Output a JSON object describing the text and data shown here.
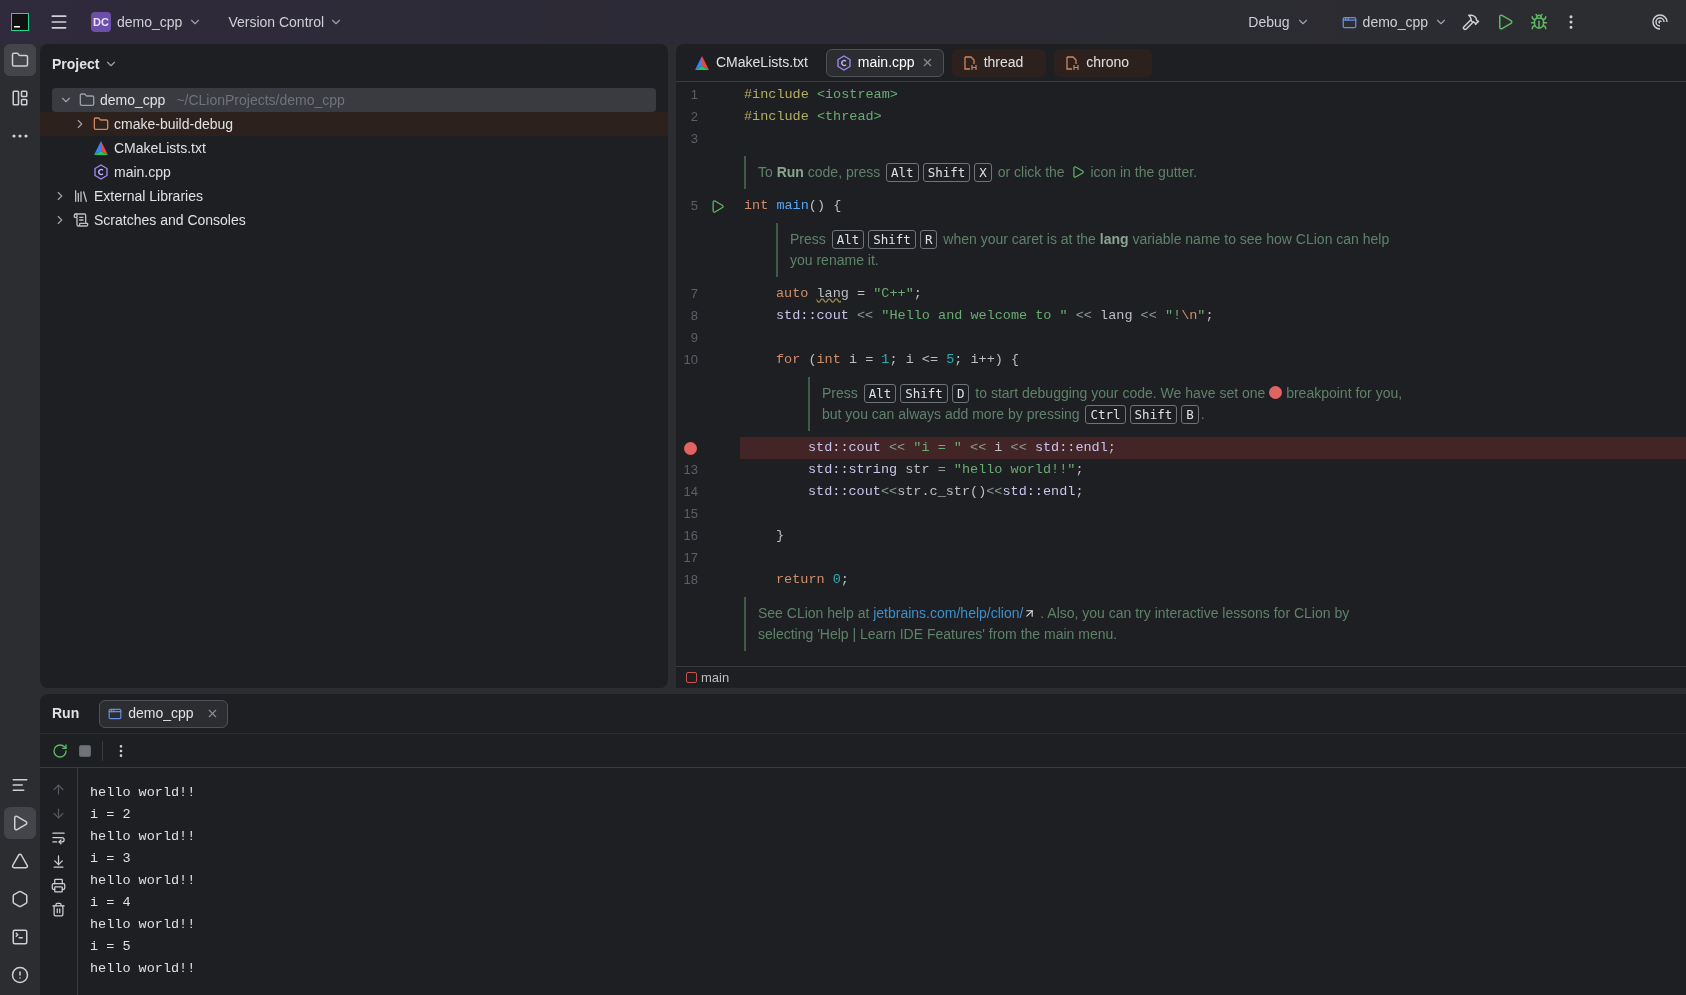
{
  "top_bar": {
    "project_badge": "DC",
    "project": "demo_cpp",
    "vcs": "Version Control",
    "mode": "Debug",
    "run_config": "demo_cpp"
  },
  "left_toolbar": {
    "top": [
      {
        "kind": "folder",
        "selected": true
      },
      {
        "kind": "structure",
        "selected": false
      },
      {
        "kind": "more",
        "selected": false
      }
    ],
    "bottom": [
      {
        "kind": "list",
        "selected": false
      },
      {
        "kind": "run",
        "selected": true
      },
      {
        "kind": "cmake",
        "selected": false
      },
      {
        "kind": "services",
        "selected": false
      },
      {
        "kind": "terminal",
        "selected": false
      },
      {
        "kind": "problems",
        "selected": false
      }
    ]
  },
  "project": {
    "title": "Project",
    "tree": [
      {
        "label": "demo_cpp",
        "path": "~/CLionProjects/demo_cpp",
        "kind": "module",
        "expanded": true,
        "selected": true,
        "excluded": false,
        "children": [
          {
            "label": "cmake-build-debug",
            "kind": "folder",
            "expanded": false,
            "selected": false,
            "excluded": true
          },
          {
            "label": "CMakeLists.txt",
            "kind": "cmake",
            "expanded": false,
            "selected": false,
            "excluded": false
          },
          {
            "label": "main.cpp",
            "kind": "cpp",
            "expanded": false,
            "selected": false,
            "excluded": false
          }
        ]
      },
      {
        "label": "External Libraries",
        "kind": "libraries",
        "expanded": false,
        "selected": false,
        "excluded": false
      },
      {
        "label": "Scratches and Consoles",
        "kind": "scratches",
        "expanded": false,
        "selected": false,
        "excluded": false
      }
    ]
  },
  "editor": {
    "tabs": [
      {
        "label": "CMakeLists.txt",
        "kind": "cmake",
        "selected": false,
        "readonly": false
      },
      {
        "label": "main.cpp",
        "kind": "cpp",
        "selected": true,
        "readonly": false
      },
      {
        "label": "thread",
        "kind": "header",
        "selected": false,
        "readonly": true
      },
      {
        "label": "chrono",
        "kind": "header",
        "selected": false,
        "readonly": true
      }
    ],
    "lines": [
      {
        "kind": "code",
        "number": "1",
        "breakpoint": false,
        "tokens": [
          {
            "kind": "directive",
            "text": "#include"
          },
          {
            "kind": "string",
            "text": " <iostream>"
          }
        ]
      },
      {
        "kind": "code",
        "number": "2",
        "breakpoint": false,
        "tokens": [
          {
            "kind": "directive",
            "text": "#include"
          },
          {
            "kind": "string",
            "text": " <thread>"
          }
        ]
      },
      {
        "kind": "code",
        "number": "3",
        "breakpoint": false
      },
      {
        "kind": "hint",
        "parts": [
          {
            "kind": "text",
            "text": "To "
          },
          {
            "kind": "bold",
            "text": "Run"
          },
          {
            "kind": "text",
            "text": " code, press "
          },
          {
            "kind": "key",
            "text": "Alt"
          },
          {
            "kind": "key",
            "text": "Shift"
          },
          {
            "kind": "key",
            "text": "X"
          },
          {
            "kind": "text",
            "text": " or click the "
          },
          {
            "kind": "run_icon"
          },
          {
            "kind": "text",
            "text": " icon in the gutter."
          }
        ]
      },
      {
        "kind": "code",
        "number": "5",
        "run_marker": true,
        "breakpoint": false,
        "tokens": [
          {
            "kind": "keyword",
            "text": "int"
          },
          {
            "kind": "function",
            "text": " main"
          },
          {
            "kind": "plain",
            "text": "() {"
          }
        ],
        "children": [
          {
            "kind": "hint",
            "parts": [
              {
                "kind": "text",
                "text": "Press "
              },
              {
                "kind": "key",
                "text": "Alt"
              },
              {
                "kind": "key",
                "text": "Shift"
              },
              {
                "kind": "key",
                "text": "R"
              },
              {
                "kind": "text",
                "text": " when your caret is at the "
              },
              {
                "kind": "bold",
                "text": "lang"
              },
              {
                "kind": "text",
                "text": " variable name to see how CLion can help you rename it."
              }
            ]
          },
          {
            "kind": "code",
            "number": "7",
            "breakpoint": false,
            "tokens": [
              {
                "kind": "keyword",
                "text": "auto "
              },
              {
                "kind": "flagged",
                "text": "lang"
              },
              {
                "kind": "plain",
                "text": " = "
              },
              {
                "kind": "string",
                "text": "\"C++\""
              },
              {
                "kind": "plain",
                "text": ";"
              }
            ]
          },
          {
            "kind": "code",
            "number": "8",
            "breakpoint": false,
            "tokens": [
              {
                "kind": "ns",
                "text": "std::cout"
              },
              {
                "kind": "op",
                "text": " <<"
              },
              {
                "kind": "string",
                "text": " \"Hello and welcome to \""
              },
              {
                "kind": "op",
                "text": " <<"
              },
              {
                "kind": "plain",
                "text": " lang"
              },
              {
                "kind": "op",
                "text": " <<"
              },
              {
                "kind": "string",
                "text": " \"!"
              },
              {
                "kind": "escape",
                "text": "\\n"
              },
              {
                "kind": "string",
                "text": "\""
              },
              {
                "kind": "plain",
                "text": ";"
              }
            ]
          },
          {
            "kind": "code",
            "number": "9",
            "breakpoint": false
          },
          {
            "kind": "code",
            "number": "10",
            "breakpoint": false,
            "tokens": [
              {
                "kind": "keyword",
                "text": "for"
              },
              {
                "kind": "plain",
                "text": " ("
              },
              {
                "kind": "keyword",
                "text": "int"
              },
              {
                "kind": "plain",
                "text": " i = "
              },
              {
                "kind": "number",
                "text": "1"
              },
              {
                "kind": "plain",
                "text": "; i <= "
              },
              {
                "kind": "number",
                "text": "5"
              },
              {
                "kind": "plain",
                "text": "; i++) {"
              }
            ],
            "children": [
              {
                "kind": "hint",
                "parts": [
                  {
                    "kind": "text",
                    "text": "Press "
                  },
                  {
                    "kind": "key",
                    "text": "Alt"
                  },
                  {
                    "kind": "key",
                    "text": "Shift"
                  },
                  {
                    "kind": "key",
                    "text": "D"
                  },
                  {
                    "kind": "text",
                    "text": " to start debugging your code. We have set one "
                  },
                  {
                    "kind": "dot"
                  },
                  {
                    "kind": "text",
                    "text": " breakpoint for you, but you can always add more by pressing "
                  },
                  {
                    "kind": "key",
                    "text": "Ctrl"
                  },
                  {
                    "kind": "key",
                    "text": "Shift"
                  },
                  {
                    "kind": "key",
                    "text": "B"
                  },
                  {
                    "kind": "text",
                    "text": "."
                  }
                ]
              },
              {
                "kind": "code",
                "breakpoint": true,
                "tokens": [
                  {
                    "kind": "ns",
                    "text": "std::cout"
                  },
                  {
                    "kind": "op",
                    "text": " <<"
                  },
                  {
                    "kind": "string",
                    "text": " \"i = \""
                  },
                  {
                    "kind": "op",
                    "text": " <<"
                  },
                  {
                    "kind": "plain",
                    "text": " i"
                  },
                  {
                    "kind": "op",
                    "text": " <<"
                  },
                  {
                    "kind": "ns",
                    "text": " std::endl"
                  },
                  {
                    "kind": "plain",
                    "text": ";"
                  }
                ]
              },
              {
                "kind": "code",
                "number": "13",
                "breakpoint": false,
                "tokens": [
                  {
                    "kind": "ns",
                    "text": "std::string"
                  },
                  {
                    "kind": "plain",
                    "text": " str "
                  },
                  {
                    "kind": "op",
                    "text": "="
                  },
                  {
                    "kind": "string",
                    "text": " \"hello world!!\""
                  },
                  {
                    "kind": "plain",
                    "text": ";"
                  }
                ]
              },
              {
                "kind": "code",
                "number": "14",
                "breakpoint": false,
                "tokens": [
                  {
                    "kind": "ns",
                    "text": "std::cout"
                  },
                  {
                    "kind": "op",
                    "text": "<<"
                  },
                  {
                    "kind": "plain",
                    "text": "str.c_str()"
                  },
                  {
                    "kind": "op",
                    "text": "<<"
                  },
                  {
                    "kind": "ns",
                    "text": "std::endl"
                  },
                  {
                    "kind": "plain",
                    "text": ";"
                  }
                ]
              },
              {
                "kind": "code",
                "number": "15",
                "breakpoint": false
              }
            ]
          },
          {
            "kind": "code",
            "number": "16",
            "breakpoint": false,
            "tokens": [
              {
                "kind": "plain",
                "text": "}"
              }
            ]
          },
          {
            "kind": "code",
            "number": "17",
            "breakpoint": false
          },
          {
            "kind": "code",
            "number": "18",
            "breakpoint": false,
            "tokens": [
              {
                "kind": "keyword",
                "text": "return"
              },
              {
                "kind": "number",
                "text": " 0"
              },
              {
                "kind": "plain",
                "text": ";"
              }
            ]
          }
        ]
      },
      {
        "kind": "hint",
        "parts": [
          {
            "kind": "text",
            "text": "See CLion help at "
          },
          {
            "kind": "link",
            "text": "jetbrains.com/help/clion/"
          },
          {
            "kind": "text",
            "text": " . Also, you can try interactive lessons for CLion by selecting 'Help | Learn IDE Features' from the main menu."
          }
        ]
      }
    ],
    "breadcrumb": "main"
  },
  "run": {
    "title": "Run",
    "tab": "demo_cpp",
    "output": [
      "hello world!!",
      "i = 2",
      "hello world!!",
      "i = 3",
      "hello world!!",
      "i = 4",
      "hello world!!",
      "i = 5",
      "hello world!!"
    ]
  }
}
